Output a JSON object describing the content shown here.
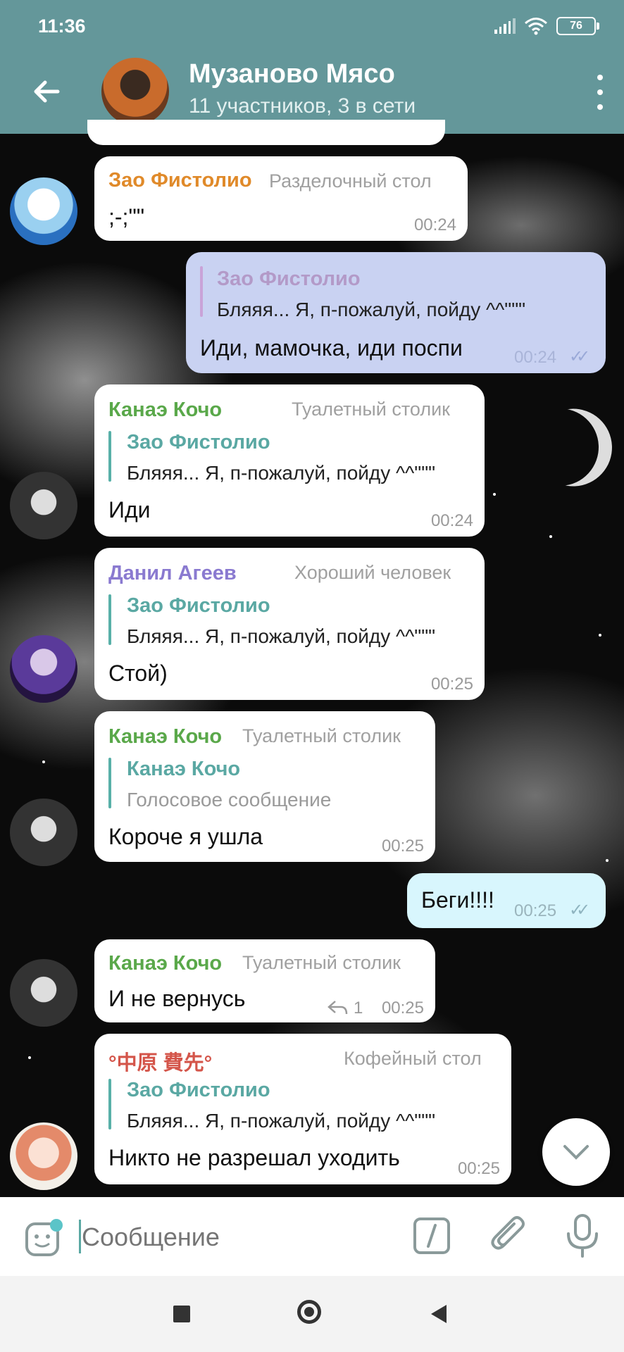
{
  "status": {
    "time": "11:36",
    "battery": "76"
  },
  "header": {
    "title": "Музаново Мясо",
    "subtitle": "11 участников, 3 в сети"
  },
  "messages": [
    {
      "name": "Зао Фистолио",
      "tag": "Разделочный стол",
      "text": ";-;\"\"",
      "time": "00:24"
    },
    {
      "reply_name": "Зао Фистолио",
      "reply_text": "Бляяя... Я, п-пожалуй, пойду ^^\"\"\"",
      "text": "Иди, мамочка, иди поспи",
      "time": "00:24"
    },
    {
      "name": "Канаэ Кочо",
      "tag": "Туалетный столик",
      "reply_name": "Зао Фистолио",
      "reply_text": "Бляяя... Я, п-пожалуй, пойду ^^\"\"\"",
      "text": "Иди",
      "time": "00:24"
    },
    {
      "name": "Данил Агеев",
      "tag": "Хороший человек",
      "reply_name": "Зао Фистолио",
      "reply_text": "Бляяя... Я, п-пожалуй, пойду ^^\"\"\"",
      "text": "Стой)",
      "time": "00:25"
    },
    {
      "name": "Канаэ Кочо",
      "tag": "Туалетный столик",
      "reply_name": "Канаэ Кочо",
      "reply_text": "Голосовое сообщение",
      "text": "Короче я ушла",
      "time": "00:25"
    },
    {
      "text": "Беги!!!!",
      "time": "00:25"
    },
    {
      "name": "Канаэ Кочо",
      "tag": "Туалетный столик",
      "text": "И не вернусь",
      "replies": "1",
      "time": "00:25"
    },
    {
      "name": "°中原 費先°",
      "tag": "Кофейный стол",
      "reply_name": "Зао Фистолио",
      "reply_text": "Бляяя... Я, п-пожалуй, пойду ^^\"\"\"",
      "text": "Никто не разрешал уходить",
      "time": "00:25"
    }
  ],
  "input": {
    "placeholder": "Сообщение"
  },
  "colors": {
    "header": "#64979a",
    "accent": "#5aa8a3",
    "outgoing": "#c9d2f2"
  },
  "icons": [
    "back-arrow-icon",
    "more-vert-icon",
    "sticker-icon",
    "command-icon",
    "attach-icon",
    "mic-icon",
    "chevron-down-icon"
  ]
}
